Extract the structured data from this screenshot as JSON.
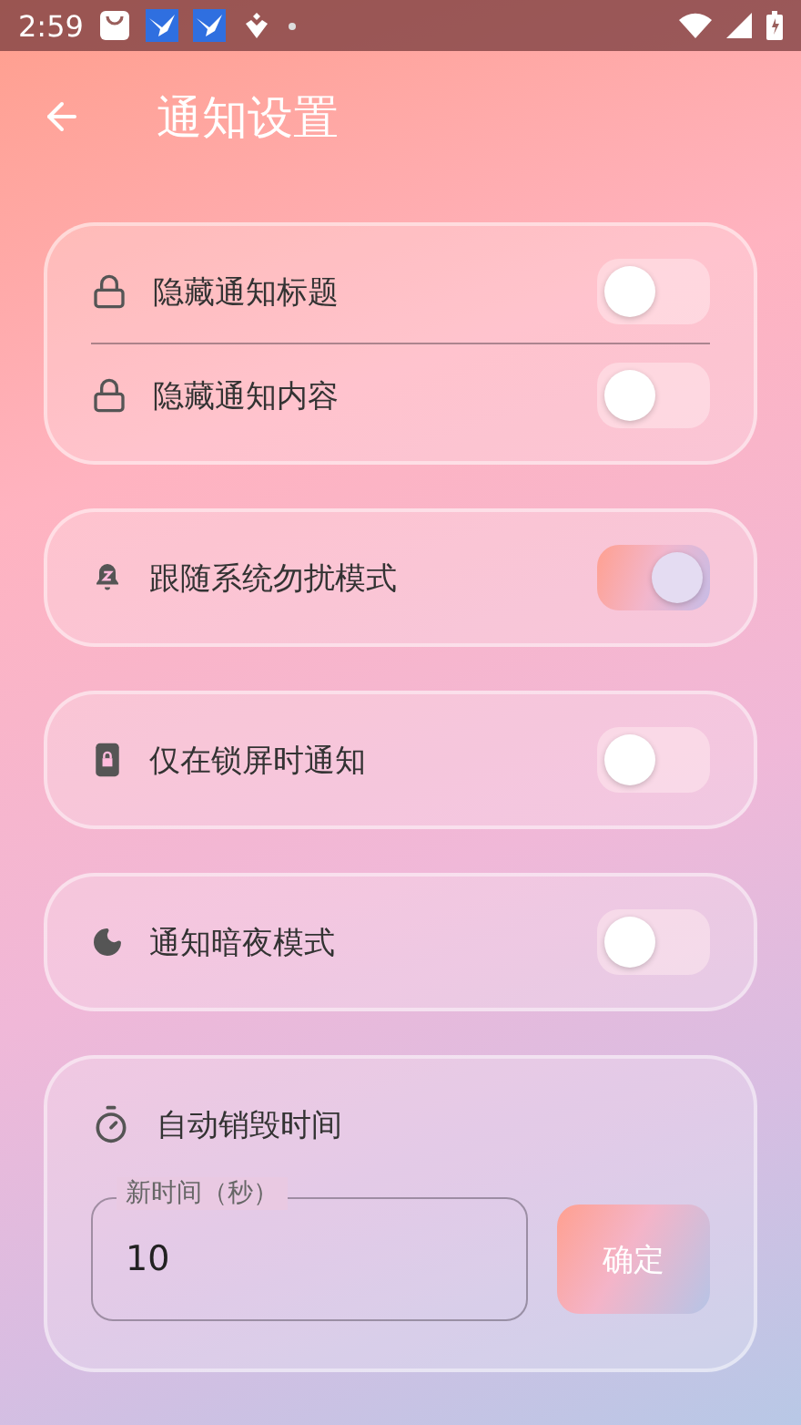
{
  "status_bar": {
    "time": "2:59"
  },
  "title": "通知设置",
  "groups": [
    {
      "rows": [
        {
          "label": "隐藏通知标题",
          "on": false
        },
        {
          "label": "隐藏通知内容",
          "on": false
        }
      ]
    },
    {
      "rows": [
        {
          "label": "跟随系统勿扰模式",
          "on": true
        }
      ]
    },
    {
      "rows": [
        {
          "label": "仅在锁屏时通知",
          "on": false
        }
      ]
    },
    {
      "rows": [
        {
          "label": "通知暗夜模式",
          "on": false
        }
      ]
    }
  ],
  "timer": {
    "label": "自动销毁时间",
    "field": {
      "label": "新时间（秒）",
      "value": "10"
    },
    "button": "确定"
  }
}
